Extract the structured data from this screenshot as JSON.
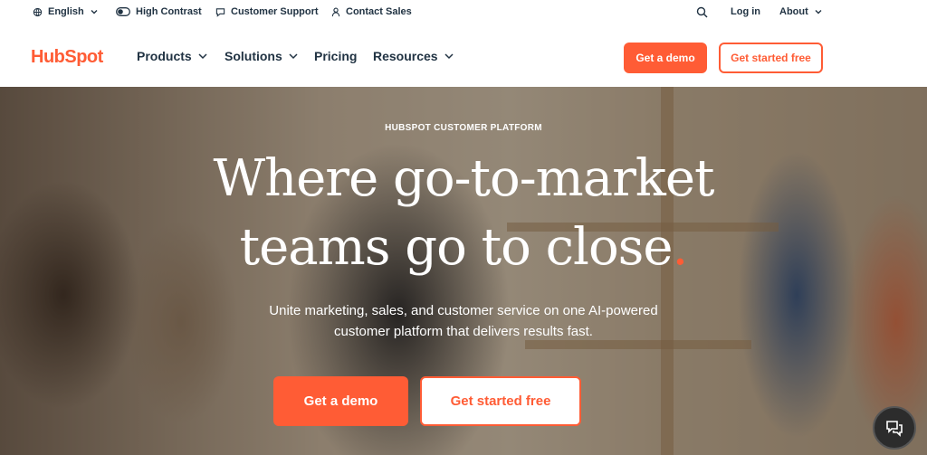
{
  "utility_bar": {
    "language": "English",
    "high_contrast": "High Contrast",
    "support": "Customer Support",
    "contact_sales": "Contact Sales",
    "login": "Log in",
    "about": "About"
  },
  "nav": {
    "logo": "HubSpot",
    "products": "Products",
    "solutions": "Solutions",
    "pricing": "Pricing",
    "resources": "Resources",
    "demo": "Get a demo",
    "free": "Get started free"
  },
  "hero": {
    "eyebrow": "HUBSPOT CUSTOMER PLATFORM",
    "headline_line1": "Where go-to-market",
    "headline_line2": "teams go to close",
    "headline_dot": ".",
    "subtext_line1": "Unite marketing, sales, and customer service on one AI-powered",
    "subtext_line2": "customer platform that delivers results fast.",
    "demo": "Get a demo",
    "free": "Get started free"
  },
  "colors": {
    "accent": "#ff5c35",
    "text": "#213343"
  },
  "icons": [
    "globe-icon",
    "contrast-icon",
    "chat-bubble-icon",
    "user-icon",
    "search-icon",
    "chevron-down-icon",
    "chat-widget-icon"
  ]
}
